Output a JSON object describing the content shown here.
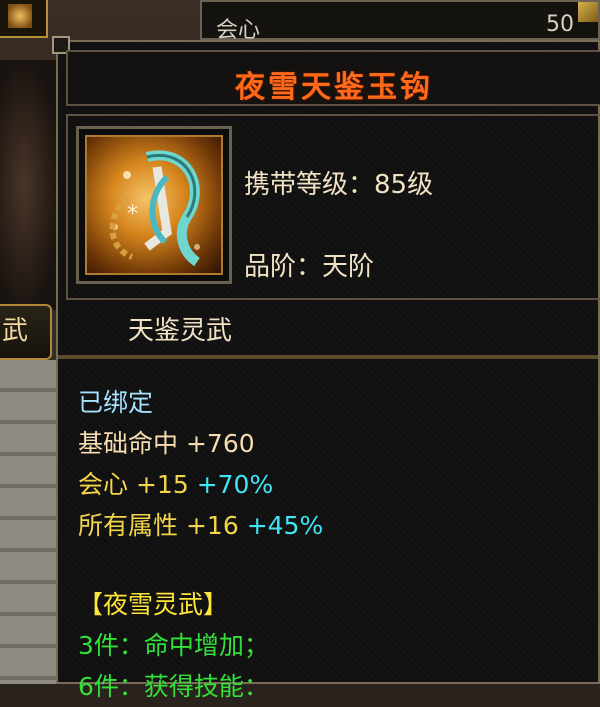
{
  "background": {
    "top_bar_label": "会心",
    "top_bar_value": "50",
    "side_tab_label": "武"
  },
  "tooltip": {
    "item_name": "夜雪天鉴玉钩",
    "item_icon": "jade-hook-weapon-icon",
    "carry_level": "携带等级：85级",
    "grade": "品阶：天阶",
    "category": "天鉴灵武",
    "bound": "已绑定",
    "stats": [
      {
        "name": "基础命中",
        "value": "+760",
        "bonus": ""
      },
      {
        "name": "会心",
        "value": "+15",
        "bonus": "+70%"
      },
      {
        "name": "所有属性",
        "value": "+16",
        "bonus": "+45%"
      }
    ],
    "set_title": "【夜雪灵武】",
    "set_bonuses": [
      "3件：命中增加；",
      "6件：获得技能："
    ]
  },
  "colors": {
    "title": "#ff6a1a",
    "bound": "#a6e0ff",
    "stat": "#f6dcb0",
    "gold_stat": "#f2d54a",
    "bonus": "#3ee6f6",
    "set_title": "#ffe638",
    "set_bonus": "#33e03a"
  }
}
